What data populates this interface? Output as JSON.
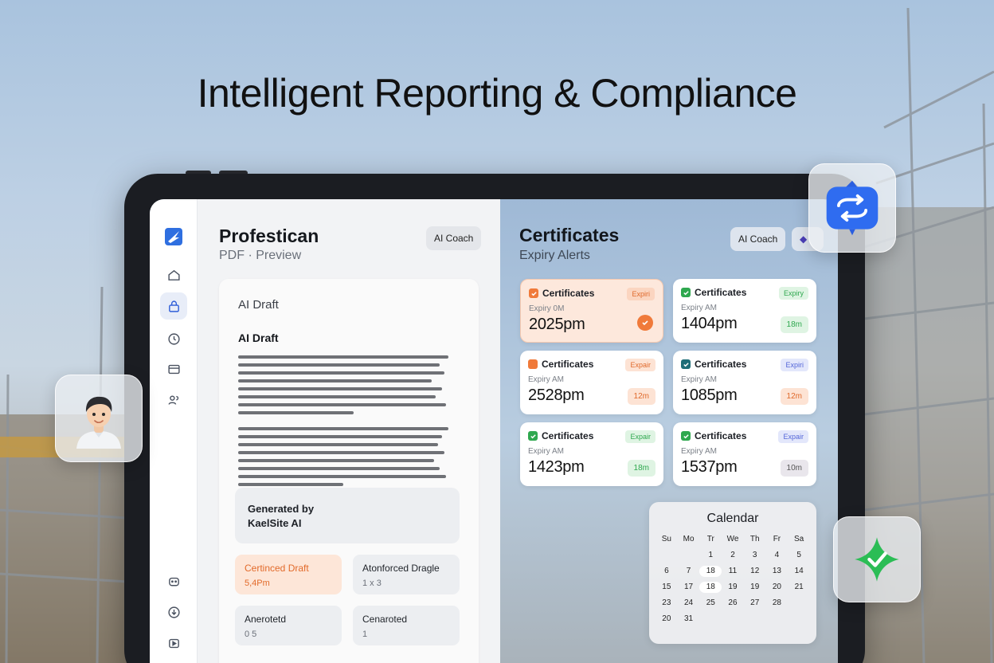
{
  "hero": {
    "title": "Intelligent Reporting & Compliance"
  },
  "left": {
    "title": "Profestican",
    "subtitle": "PDF · Preview",
    "coach_label": "AI Coach",
    "draft_label": "AI Draft",
    "draft_heading": "AI Draft",
    "generated_line1": "Generated by",
    "generated_line2": "KaelSite AI",
    "cards": [
      {
        "title": "Certinced Draft",
        "value": "5,4Pm"
      },
      {
        "title": "Atonforced Dragle",
        "value": "1 x 3"
      },
      {
        "title": "Anerotetd",
        "value": "0 5"
      },
      {
        "title": "Cenaroted",
        "value": "1"
      }
    ]
  },
  "right": {
    "title": "Certificates",
    "subtitle": "Expiry Alerts",
    "coach_label": "AI Coach",
    "certs": [
      {
        "title": "Certificates",
        "sub": "Expiry 0M",
        "value": "2025pm",
        "badge": "Expiri",
        "tag": ""
      },
      {
        "title": "Certificates",
        "sub": "Expiry AM",
        "value": "1404pm",
        "badge": "Expiry",
        "tag": "18m"
      },
      {
        "title": "Certificates",
        "sub": "Expiry AM",
        "value": "2528pm",
        "badge": "Expair",
        "tag": "12m"
      },
      {
        "title": "Certificates",
        "sub": "Expiry AM",
        "value": "1085pm",
        "badge": "Expiri",
        "tag": "12m"
      },
      {
        "title": "Certificates",
        "sub": "Expiry AM",
        "value": "1423pm",
        "badge": "Expair",
        "tag": "18m"
      },
      {
        "title": "Certificates",
        "sub": "Expiry AM",
        "value": "1537pm",
        "badge": "Expair",
        "tag": "10m"
      }
    ]
  },
  "calendar": {
    "title": "Calendar",
    "days": [
      "Su",
      "Mo",
      "Tr",
      "We",
      "Th",
      "Fr",
      "Sa"
    ],
    "cells": [
      "",
      "",
      "1",
      "2",
      "3",
      "4",
      "5",
      "6",
      "7",
      "18",
      "11",
      "12",
      "13",
      "14",
      "15",
      "17",
      "18",
      "19",
      "19",
      "20",
      "21",
      "23",
      "24",
      "25",
      "26",
      "27",
      "28",
      "",
      "20",
      "31",
      "",
      "",
      "",
      "",
      ""
    ]
  },
  "icons": {
    "app_logo": "bolt-logo-icon",
    "sidebar": [
      "home-icon",
      "lock-icon",
      "clock-icon",
      "card-icon",
      "users-icon"
    ],
    "sidebar_bottom": [
      "chat-icon",
      "download-icon",
      "play-icon"
    ],
    "floating": [
      "sync-icon",
      "check-star-icon",
      "avatar-icon"
    ]
  },
  "colors": {
    "accent_blue": "#2f5ed8",
    "orange": "#f07a3a",
    "green": "#2fa84f",
    "teal": "#1f6e78"
  }
}
